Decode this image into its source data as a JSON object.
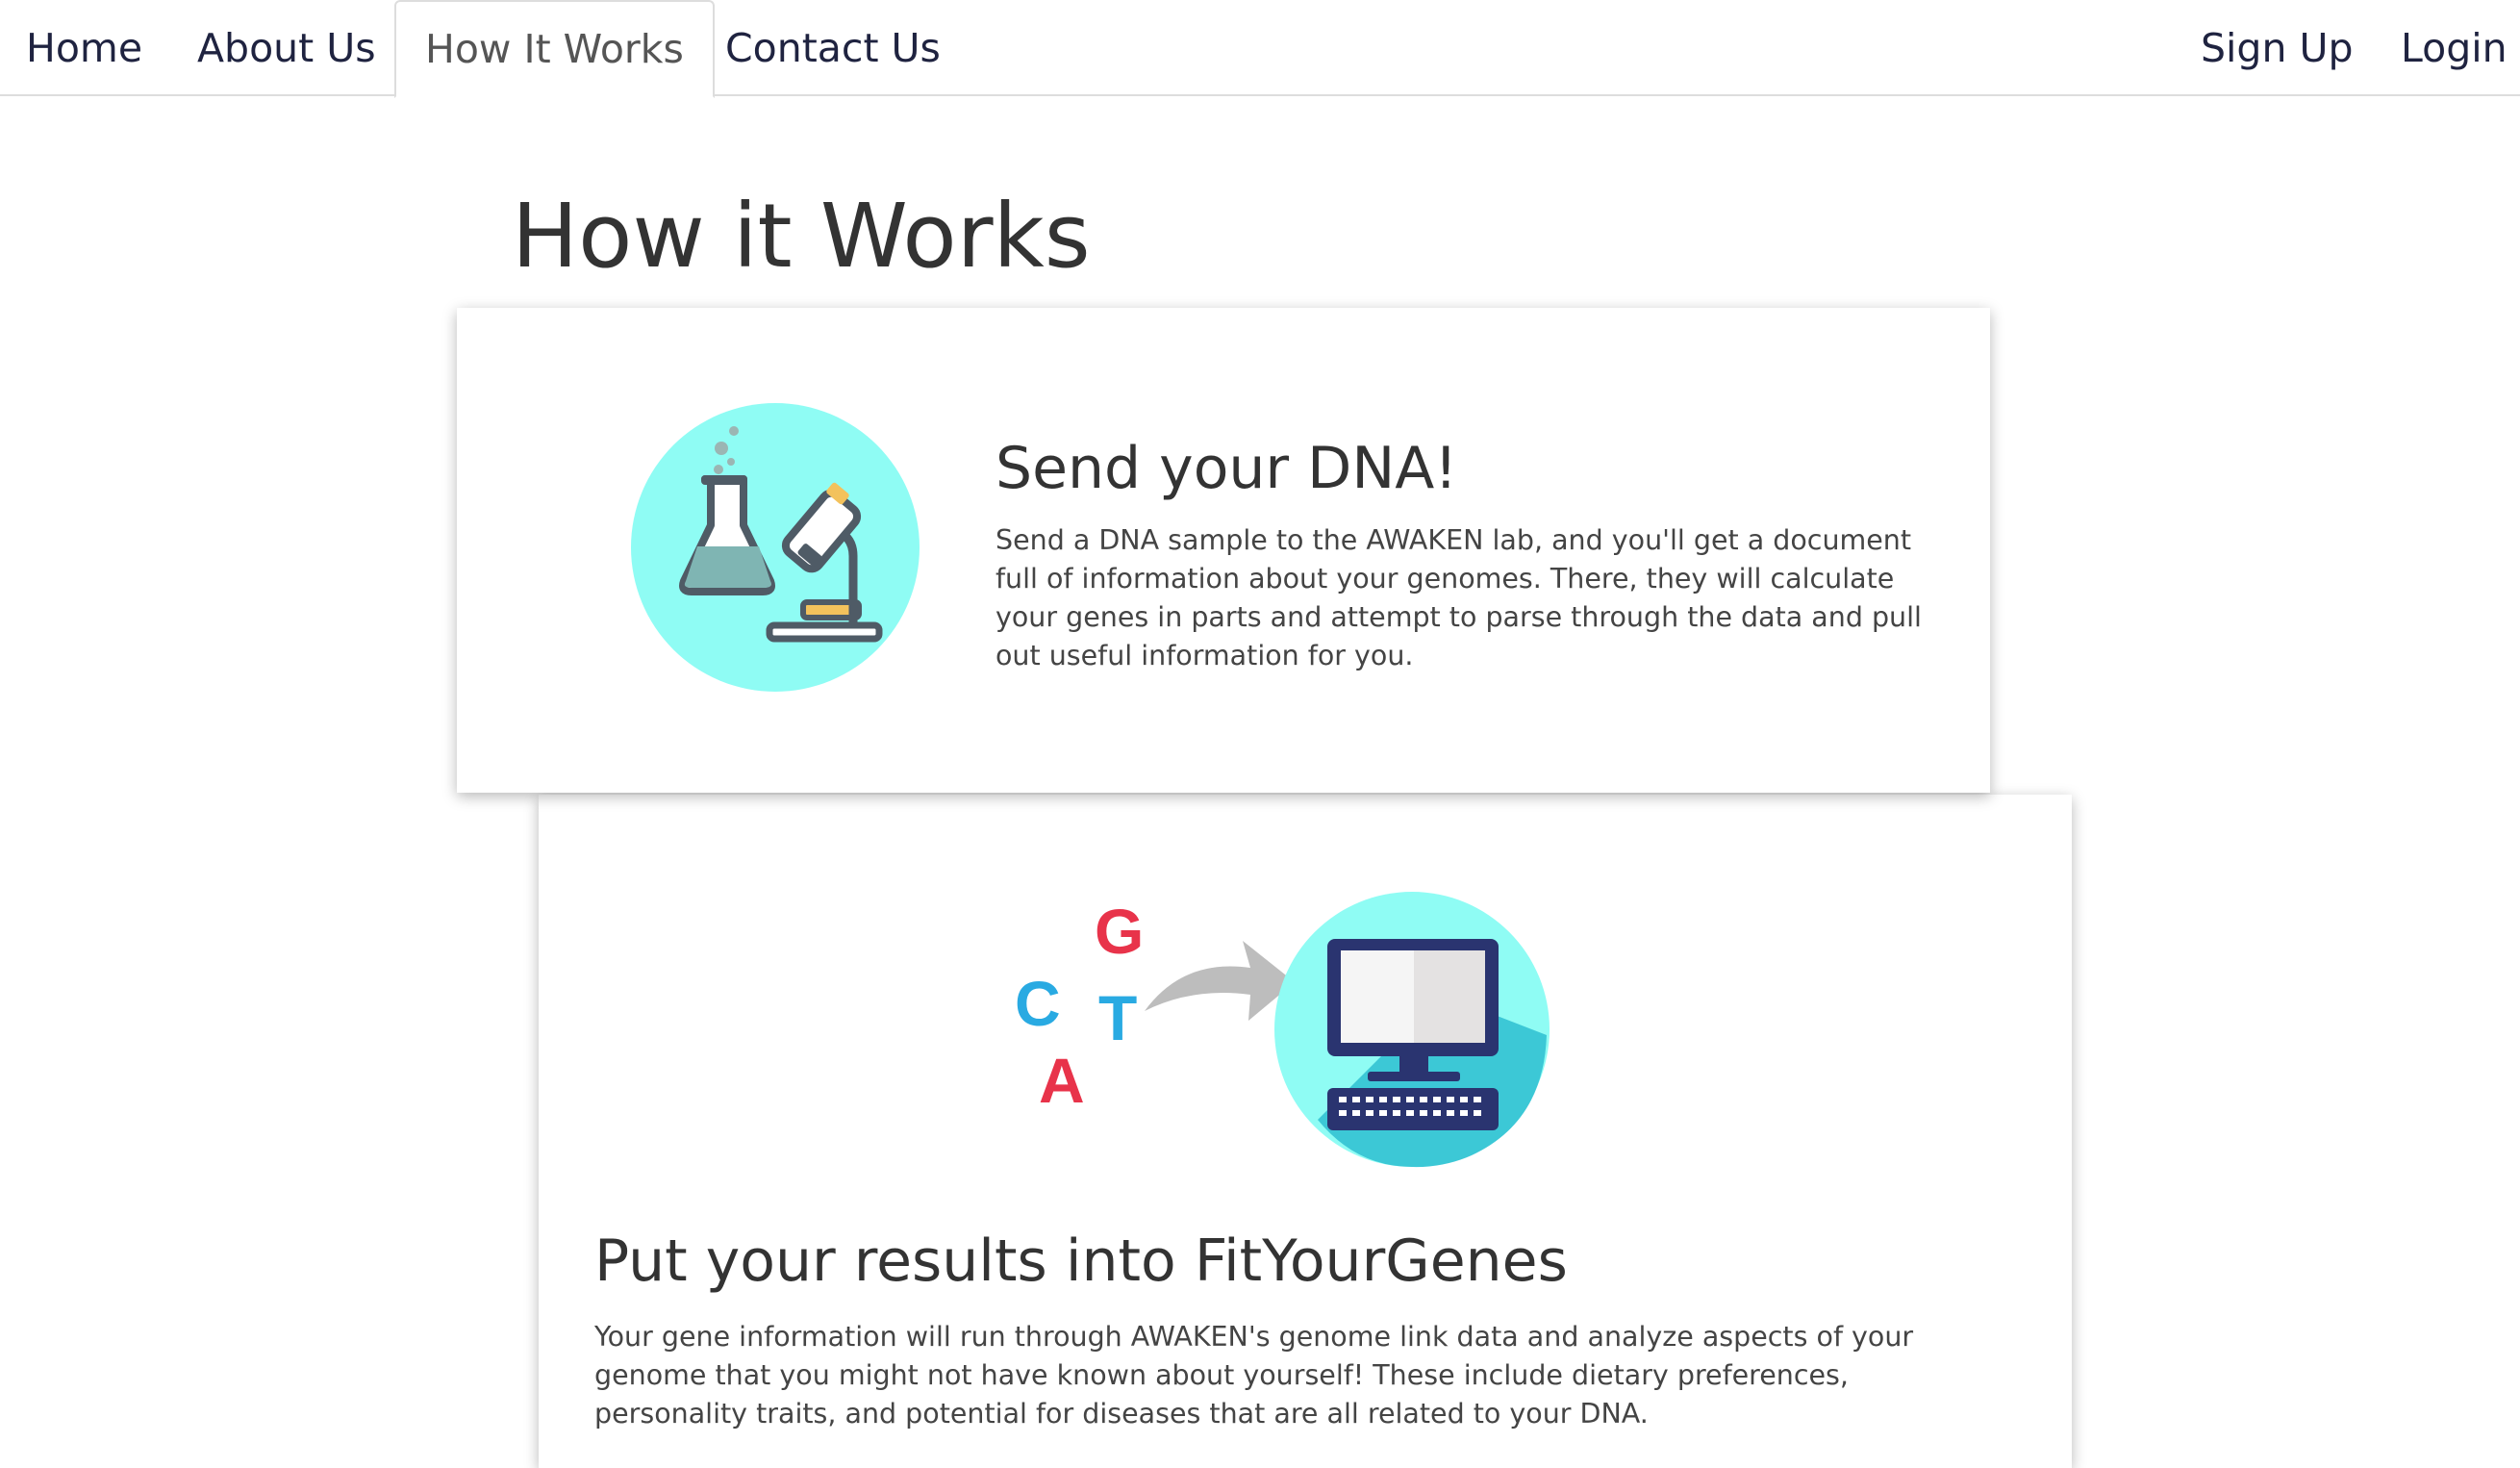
{
  "nav": {
    "left": [
      "Home",
      "About Us",
      "How It Works",
      "Contact Us"
    ],
    "right": [
      "Sign Up",
      "Login"
    ],
    "active": "How It Works"
  },
  "page": {
    "title": "How it Works"
  },
  "steps": [
    {
      "title": "Send your DNA!",
      "text": "Send a DNA sample to the AWAKEN lab, and you'll get a document full of information about your genomes. There, they will calculate your genes in parts and attempt to parse through the data and pull out useful information for you.",
      "icon": "lab-flask-microscope-icon"
    },
    {
      "title": "Put your results into FitYourGenes",
      "text": "Your gene information will run through AWAKEN's genome link data and analyze aspects of your genome that you might not have known about yourself! These include dietary preferences, personality traits, and potential for diseases that are all related to your DNA.",
      "icon": "dna-to-computer-icon",
      "letters": [
        "G",
        "C",
        "T",
        "A"
      ]
    }
  ],
  "colors": {
    "nav_text": "#1f2340",
    "circle": "#8ffcf4",
    "letter_red": "#e8334a",
    "letter_blue": "#29aae2",
    "arrow": "#bdbdbd",
    "computer_dark": "#2a3470"
  }
}
